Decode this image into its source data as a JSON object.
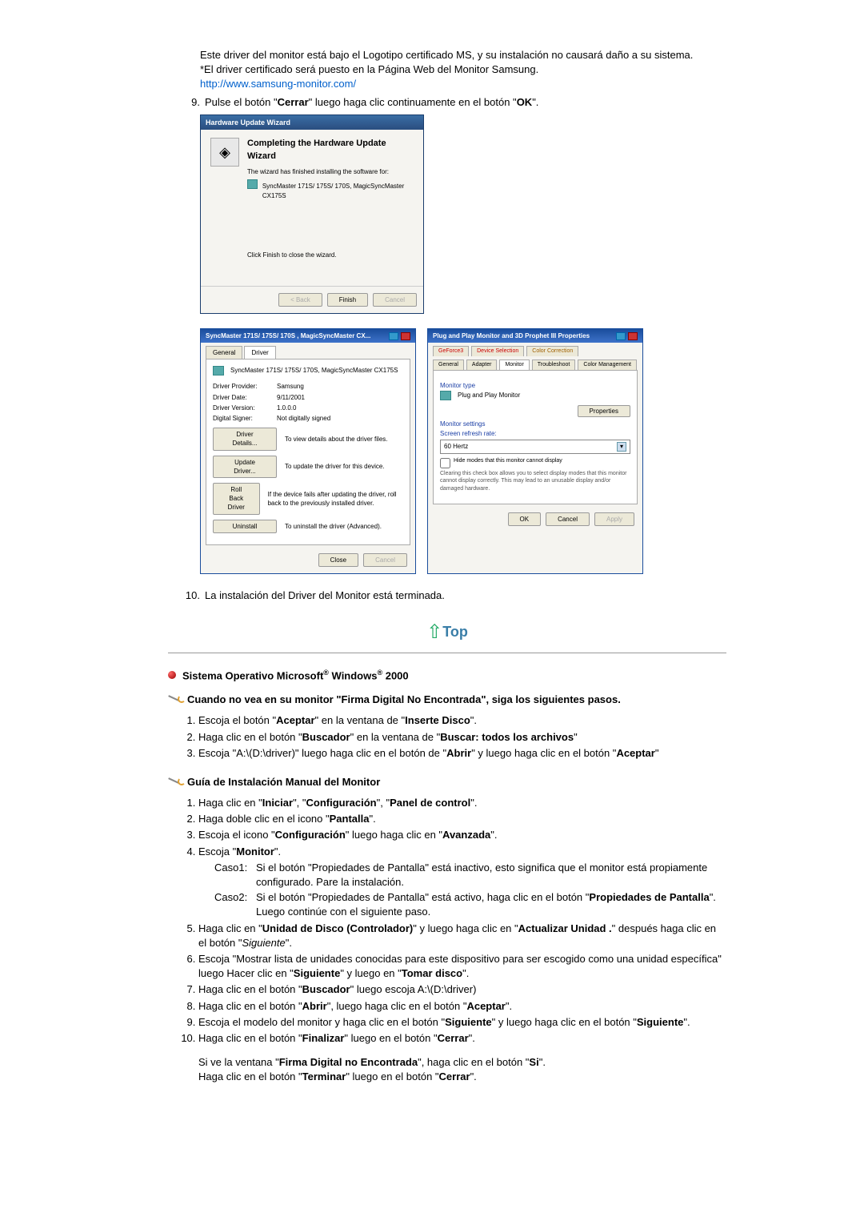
{
  "intro": {
    "line1": "Este driver del monitor está bajo el Logotipo certificado MS, y su instalación no causará daño a su sistema.",
    "line2": "*El driver certificado será puesto en la Página Web del Monitor Samsung.",
    "link": "http://www.samsung-monitor.com/"
  },
  "step9": {
    "num": "9.",
    "t1": "Pulse el botón \"",
    "b1": "Cerrar",
    "t2": "\" luego haga clic continuamente en el botón \"",
    "b2": "OK",
    "t3": "\"."
  },
  "wizard": {
    "title": "Hardware Update Wizard",
    "heading": "Completing the Hardware Update Wizard",
    "line1": "The wizard has finished installing the software for:",
    "device": "SyncMaster 171S/ 175S/ 170S, MagicSyncMaster CX175S",
    "line2": "Click Finish to close the wizard.",
    "buttons": {
      "back": "< Back",
      "finish": "Finish",
      "cancel": "Cancel"
    }
  },
  "propDriver": {
    "bar": "SyncMaster 171S/ 175S/ 170S , MagicSyncMaster CX...",
    "tabs": {
      "general": "General",
      "driver": "Driver"
    },
    "device": "SyncMaster 171S/ 175S/ 170S, MagicSyncMaster CX175S",
    "kv": {
      "provider_k": "Driver Provider:",
      "provider_v": "Samsung",
      "date_k": "Driver Date:",
      "date_v": "9/11/2001",
      "version_k": "Driver Version:",
      "version_v": "1.0.0.0",
      "signer_k": "Digital Signer:",
      "signer_v": "Not digitally signed"
    },
    "rows": {
      "details_btn": "Driver Details...",
      "details_txt": "To view details about the driver files.",
      "update_btn": "Update Driver...",
      "update_txt": "To update the driver for this device.",
      "rollback_btn": "Roll Back Driver",
      "rollback_txt": "If the device fails after updating the driver, roll back to the previously installed driver.",
      "uninstall_btn": "Uninstall",
      "uninstall_txt": "To uninstall the driver (Advanced)."
    },
    "foot": {
      "close": "Close",
      "cancel": "Cancel"
    }
  },
  "propMonitor": {
    "bar": "Plug and Play Monitor and 3D Prophet III Properties",
    "tabs": {
      "gf": "GeForce3",
      "ds": "Device Selection",
      "cc": "Color Correction",
      "gen": "General",
      "ad": "Adapter",
      "mon": "Monitor",
      "tr": "Troubleshoot",
      "cm": "Color Management"
    },
    "type_label": "Monitor type",
    "type_value": "Plug and Play Monitor",
    "prop_btn": "Properties",
    "settings_label": "Monitor settings",
    "refresh_label": "Screen refresh rate:",
    "refresh_value": "60 Hertz",
    "chk1": "Hide modes that this monitor cannot display",
    "chk2": "Clearing this check box allows you to select display modes that this monitor cannot display correctly. This may lead to an unusable display and/or damaged hardware.",
    "foot": {
      "ok": "OK",
      "cancel": "Cancel",
      "apply": "Apply"
    }
  },
  "step10": {
    "num": "10.",
    "text": "La instalación del Driver del Monitor está terminada."
  },
  "top_label": "Top",
  "section2000": {
    "t1": "Sistema Operativo Microsoft",
    "sup": "®",
    "t2": " Windows",
    "t3": " 2000"
  },
  "sub_sig": "Cuando no vea en su monitor \"Firma Digital No Encontrada\", siga los siguientes pasos.",
  "sig_steps": {
    "s1a": "Escoja el botón \"",
    "s1b": "Aceptar",
    "s1c": "\" en la ventana de \"",
    "s1d": "Inserte Disco",
    "s1e": "\".",
    "s2a": "Haga clic en el botón \"",
    "s2b": "Buscador",
    "s2c": "\" en la ventana de \"",
    "s2d": "Buscar: todos los archivos",
    "s2e": "\"",
    "s3a": "Escoja \"A:\\(D:\\driver)\" luego haga clic en el botón de \"",
    "s3b": "Abrir",
    "s3c": "\" y luego haga clic en el botón \"",
    "s3d": "Aceptar",
    "s3e": "\""
  },
  "sub_guide": "Guía de Instalación Manual del Monitor",
  "guide": {
    "s1a": "Haga clic en \"",
    "s1b": "Iniciar",
    "s1c": "\", \"",
    "s1d": "Configuración",
    "s1e": "\", \"",
    "s1f": "Panel de control",
    "s1g": "\".",
    "s2a": "Haga doble clic en el icono \"",
    "s2b": "Pantalla",
    "s2c": "\".",
    "s3a": "Escoja el icono \"",
    "s3b": "Configuración",
    "s3c": "\" luego haga clic en \"",
    "s3d": "Avanzada",
    "s3e": "\".",
    "s4a": "Escoja \"",
    "s4b": "Monitor",
    "s4c": "\".",
    "c1l": "Caso1:",
    "c1a": "Si el botón \"Propiedades de Pantalla\" está inactivo, esto significa que el monitor está propiamente configurado. Pare la instalación.",
    "c2l": "Caso2:",
    "c2a": "Si el botón \"Propiedades de Pantalla\" está activo, haga clic en el botón \"",
    "c2b": "Propiedades de Pantalla",
    "c2c": "\". Luego continúe con el siguiente paso.",
    "s5a": "Haga clic en \"",
    "s5b": "Unidad de Disco (Controlador)",
    "s5c": "\" y luego haga clic en \"",
    "s5d": "Actualizar Unidad .",
    "s5e": "\" después haga clic en el botón \"",
    "s5f": "Siguiente",
    "s5g": "\".",
    "s6a": "Escoja \"Mostrar lista de unidades conocidas para este dispositivo para ser escogido como una unidad específica\" luego Hacer clic en \"",
    "s6b": "Siguiente",
    "s6c": "\" y luego en \"",
    "s6d": "Tomar disco",
    "s6e": "\".",
    "s7a": "Haga clic en el botón \"",
    "s7b": "Buscador",
    "s7c": "\" luego escoja A:\\(D:\\driver)",
    "s8a": "Haga clic en el botón \"",
    "s8b": "Abrir",
    "s8c": "\", luego haga clic en el botón \"",
    "s8d": "Aceptar",
    "s8e": "\".",
    "s9a": "Escoja el modelo del monitor y haga clic en el botón \"",
    "s9b": "Siguiente",
    "s9c": "\" y luego haga clic en el botón \"",
    "s9d": "Siguiente",
    "s9e": "\".",
    "s10a": "Haga clic en el botón \"",
    "s10b": "Finalizar",
    "s10c": "\" luego en el botón \"",
    "s10d": "Cerrar",
    "s10e": "\".",
    "tail1a": "Si ve la ventana \"",
    "tail1b": "Firma Digital no Encontrada",
    "tail1c": "\", haga clic en el botón \"",
    "tail1d": "Si",
    "tail1e": "\".",
    "tail2a": "Haga clic en el botón \"",
    "tail2b": "Terminar",
    "tail2c": "\" luego en el botón \"",
    "tail2d": "Cerrar",
    "tail2e": "\"."
  }
}
